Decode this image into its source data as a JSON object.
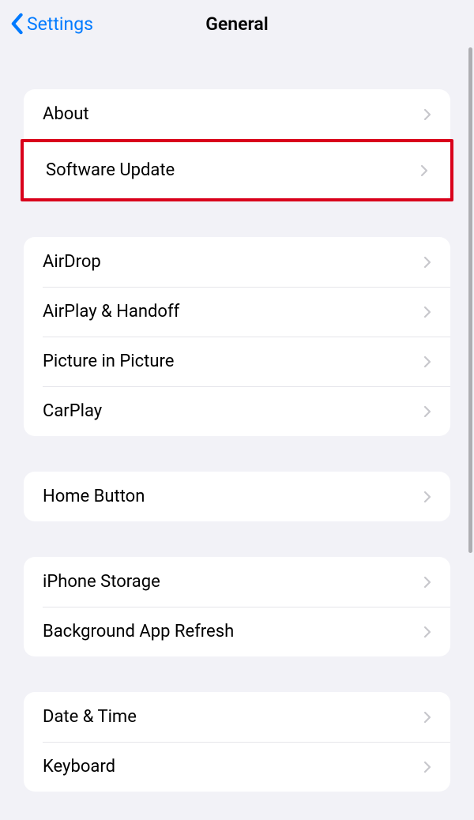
{
  "header": {
    "back_label": "Settings",
    "title": "General"
  },
  "groups": [
    {
      "items": [
        {
          "label": "About",
          "highlighted": false
        },
        {
          "label": "Software Update",
          "highlighted": true
        }
      ]
    },
    {
      "items": [
        {
          "label": "AirDrop"
        },
        {
          "label": "AirPlay & Handoff"
        },
        {
          "label": "Picture in Picture"
        },
        {
          "label": "CarPlay"
        }
      ]
    },
    {
      "items": [
        {
          "label": "Home Button"
        }
      ]
    },
    {
      "items": [
        {
          "label": "iPhone Storage"
        },
        {
          "label": "Background App Refresh"
        }
      ]
    },
    {
      "items": [
        {
          "label": "Date & Time"
        },
        {
          "label": "Keyboard"
        }
      ]
    }
  ]
}
